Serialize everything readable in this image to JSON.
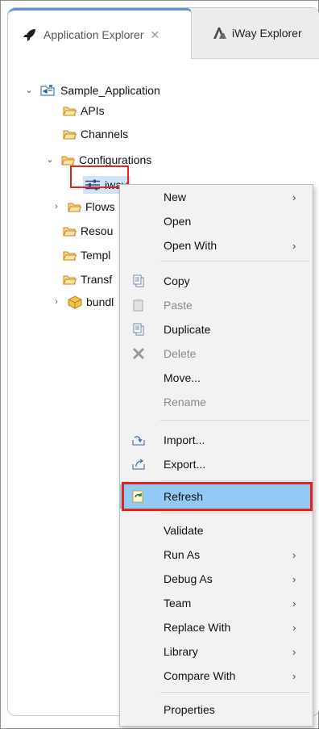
{
  "tabs": [
    {
      "label": "Application Explorer",
      "close": "✕",
      "icon": "rocket-icon",
      "active": true
    },
    {
      "label": "iWay Explorer",
      "icon": "iway-logo-icon",
      "active": false
    }
  ],
  "tree": {
    "project": "Sample_Application",
    "items": [
      "APIs",
      "Channels",
      "Configurations",
      "iway",
      "Flows",
      "Resou",
      "Templ",
      "Transf",
      "bundl"
    ]
  },
  "context_menu": {
    "items": [
      {
        "label": "New",
        "submenu": true
      },
      {
        "label": "Open"
      },
      {
        "label": "Open With",
        "submenu": true
      },
      {
        "label": "Copy"
      },
      {
        "label": "Paste",
        "disabled": true
      },
      {
        "label": "Duplicate"
      },
      {
        "label": "Delete",
        "disabled": true
      },
      {
        "label": "Move..."
      },
      {
        "label": "Rename",
        "disabled": true
      },
      {
        "label": "Import..."
      },
      {
        "label": "Export..."
      },
      {
        "label": "Refresh",
        "highlighted": true
      },
      {
        "label": "Validate"
      },
      {
        "label": "Run As",
        "submenu": true
      },
      {
        "label": "Debug As",
        "submenu": true
      },
      {
        "label": "Team",
        "submenu": true
      },
      {
        "label": "Replace With",
        "submenu": true
      },
      {
        "label": "Library",
        "submenu": true
      },
      {
        "label": "Compare With",
        "submenu": true
      },
      {
        "label": "Properties"
      }
    ],
    "arrow": "›"
  },
  "colors": {
    "highlight": "#91c9f7",
    "callout": "#e2241b",
    "folder": "#e8a23a"
  }
}
